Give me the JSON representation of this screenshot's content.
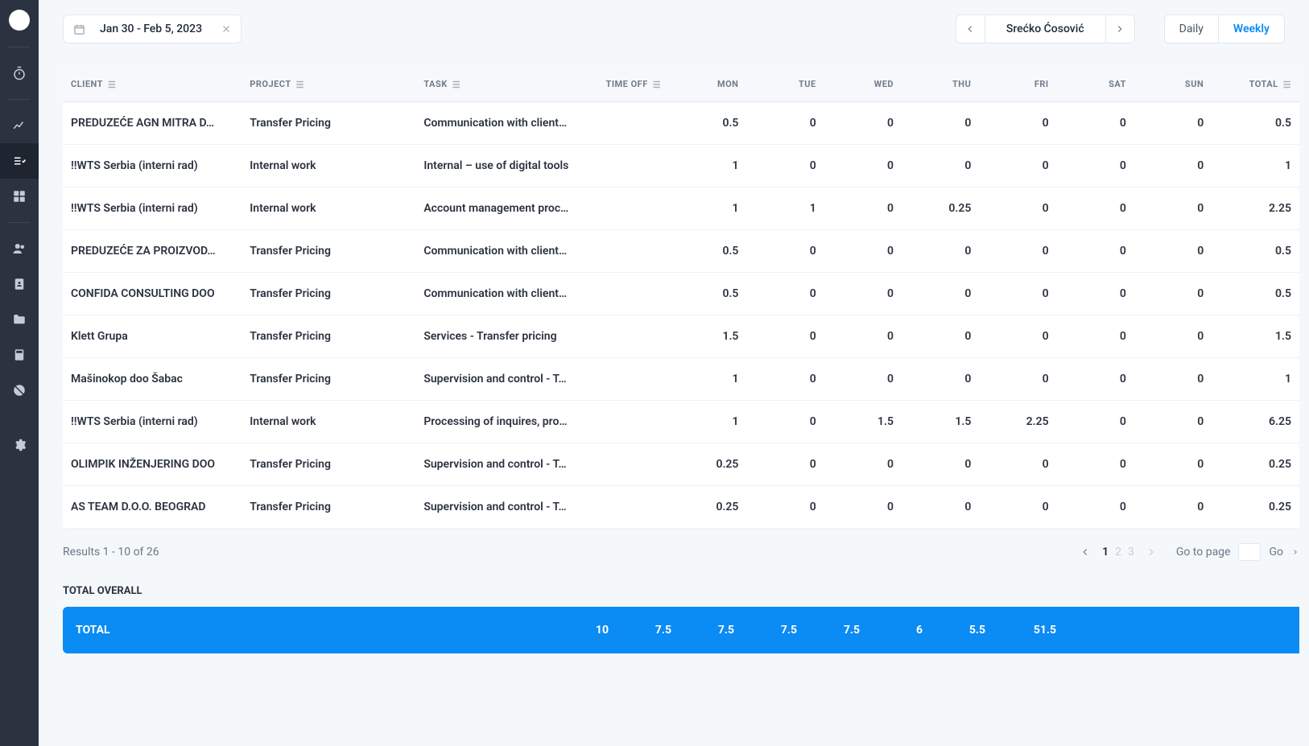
{
  "header": {
    "date_range": "Jan 30 - Feb 5, 2023",
    "user_name": "Srećko Ćosović",
    "view_daily": "Daily",
    "view_weekly": "Weekly"
  },
  "columns": {
    "client": "CLIENT",
    "project": "PROJECT",
    "task": "TASK",
    "timeoff": "TIME OFF",
    "mon": "MON",
    "tue": "TUE",
    "wed": "WED",
    "thu": "THU",
    "fri": "FRI",
    "sat": "SAT",
    "sun": "SUN",
    "total": "TOTAL"
  },
  "rows": [
    {
      "client": "PREDUZEĆE AGN MITRA D…",
      "project": "Transfer Pricing",
      "task": "Communication with client…",
      "mon": "0.5",
      "tue": "0",
      "wed": "0",
      "thu": "0",
      "fri": "0",
      "sat": "0",
      "sun": "0",
      "total": "0.5"
    },
    {
      "client": "!!WTS Serbia (interni rad)",
      "project": "Internal work",
      "task": "Internal – use of digital tools",
      "mon": "1",
      "tue": "0",
      "wed": "0",
      "thu": "0",
      "fri": "0",
      "sat": "0",
      "sun": "0",
      "total": "1"
    },
    {
      "client": "!!WTS Serbia (interni rad)",
      "project": "Internal work",
      "task": "Account management proc…",
      "mon": "1",
      "tue": "1",
      "wed": "0",
      "thu": "0.25",
      "fri": "0",
      "sat": "0",
      "sun": "0",
      "total": "2.25"
    },
    {
      "client": "PREDUZEĆE ZA PROIZVOD…",
      "project": "Transfer Pricing",
      "task": "Communication with client…",
      "mon": "0.5",
      "tue": "0",
      "wed": "0",
      "thu": "0",
      "fri": "0",
      "sat": "0",
      "sun": "0",
      "total": "0.5"
    },
    {
      "client": "CONFIDA CONSULTING DOO",
      "project": "Transfer Pricing",
      "task": "Communication with client…",
      "mon": "0.5",
      "tue": "0",
      "wed": "0",
      "thu": "0",
      "fri": "0",
      "sat": "0",
      "sun": "0",
      "total": "0.5"
    },
    {
      "client": "Klett Grupa",
      "project": "Transfer Pricing",
      "task": "Services - Transfer pricing",
      "mon": "1.5",
      "tue": "0",
      "wed": "0",
      "thu": "0",
      "fri": "0",
      "sat": "0",
      "sun": "0",
      "total": "1.5"
    },
    {
      "client": "Mašinokop doo Šabac",
      "project": "Transfer Pricing",
      "task": "Supervision and control - T…",
      "mon": "1",
      "tue": "0",
      "wed": "0",
      "thu": "0",
      "fri": "0",
      "sat": "0",
      "sun": "0",
      "total": "1"
    },
    {
      "client": "!!WTS Serbia (interni rad)",
      "project": "Internal work",
      "task": "Processing of inquires, pro…",
      "mon": "1",
      "tue": "0",
      "wed": "1.5",
      "thu": "1.5",
      "fri": "2.25",
      "sat": "0",
      "sun": "0",
      "total": "6.25"
    },
    {
      "client": "OLIMPIK INŽENJERING DOO",
      "project": "Transfer Pricing",
      "task": "Supervision and control - T…",
      "mon": "0.25",
      "tue": "0",
      "wed": "0",
      "thu": "0",
      "fri": "0",
      "sat": "0",
      "sun": "0",
      "total": "0.25"
    },
    {
      "client": "AS TEAM D.O.O. BEOGRAD",
      "project": "Transfer Pricing",
      "task": "Supervision and control - T…",
      "mon": "0.25",
      "tue": "0",
      "wed": "0",
      "thu": "0",
      "fri": "0",
      "sat": "0",
      "sun": "0",
      "total": "0.25"
    }
  ],
  "pagination": {
    "results_label": "Results 1 - 10 of 26",
    "pages": [
      "1",
      "2",
      "3"
    ],
    "current": "1",
    "goto_label": "Go to page",
    "go_label": "Go"
  },
  "totals": {
    "heading": "TOTAL OVERALL",
    "row_label": "TOTAL",
    "mon": "10",
    "tue": "7.5",
    "wed": "7.5",
    "thu": "7.5",
    "fri": "7.5",
    "sat": "6",
    "sun": "5.5",
    "total": "51.5"
  }
}
